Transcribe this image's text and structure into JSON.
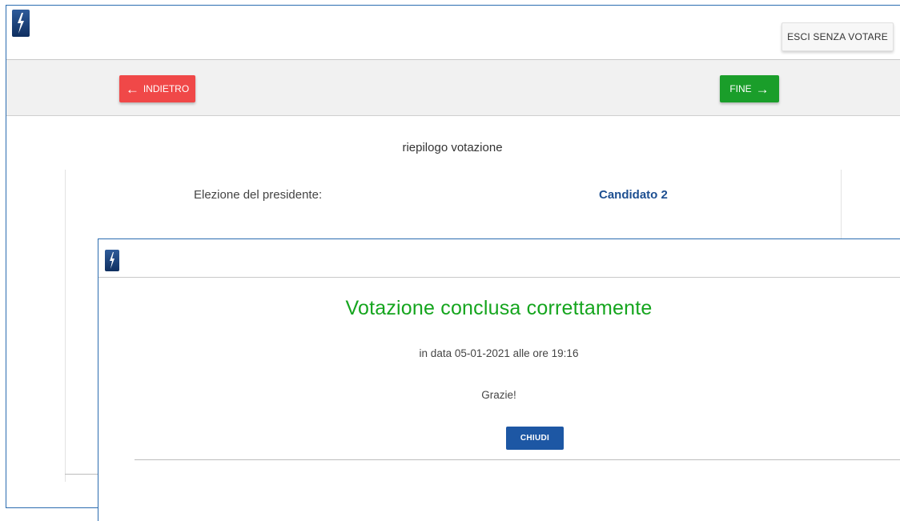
{
  "header": {
    "logo_icon": "lightning-bolt-logo-icon",
    "exit_label": "ESCI SENZA VOTARE"
  },
  "nav": {
    "back_label": "INDIETRO",
    "back_icon": "arrow-left-icon",
    "end_label": "FINE",
    "end_icon": "arrow-right-icon"
  },
  "summary": {
    "title": "riepilogo votazione",
    "rows": [
      {
        "label": "Elezione del presidente:",
        "value": "Candidato 2"
      }
    ]
  },
  "modal": {
    "title": "Votazione conclusa correttamente",
    "date_text": "in data 05-01-2021 alle ore 19:16",
    "thanks": "Grazie!",
    "close_label": "CHIUDI"
  },
  "colors": {
    "frame_border": "#2b6cb0",
    "back_button": "#f04848",
    "end_button": "#1a9e2a",
    "success_title": "#15a51e",
    "candidate_value": "#1d4f91",
    "close_button": "#1d57a4"
  }
}
